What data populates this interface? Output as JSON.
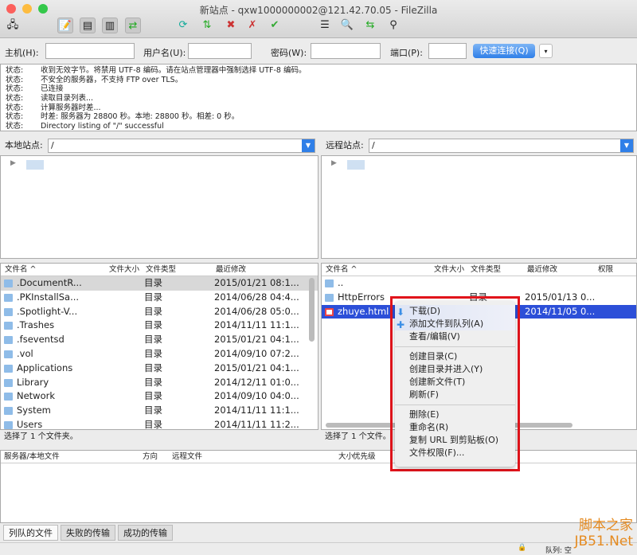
{
  "window": {
    "title": "新站点 - qxw1000000002@121.42.70.05 - FileZilla"
  },
  "toolbar": {
    "icons": [
      "site-manager-icon",
      "message-log-icon",
      "local-tree-icon",
      "remote-tree-icon",
      "transfer-queue-icon",
      "refresh-icon",
      "process-queue-icon",
      "cancel-icon",
      "disconnect-icon",
      "reconnect-icon",
      "filter-icon",
      "compare-icon",
      "sync-browse-icon",
      "search-icon"
    ]
  },
  "quickconnect": {
    "host_label": "主机(H):",
    "user_label": "用户名(U):",
    "pass_label": "密码(W):",
    "port_label": "端口(P):",
    "host": "",
    "user": "",
    "pass": "",
    "port": "",
    "button": "快速连接(Q)",
    "dropdown": "▾"
  },
  "log": [
    {
      "k": "状态:",
      "v": "收到无效字节。将禁用 UTF-8 编码。请在站点管理器中强制选择 UTF-8 编码。"
    },
    {
      "k": "状态:",
      "v": "不安全的服务器，不支持 FTP over TLS。"
    },
    {
      "k": "状态:",
      "v": "已连接"
    },
    {
      "k": "状态:",
      "v": "读取目录列表..."
    },
    {
      "k": "状态:",
      "v": "计算服务器时差..."
    },
    {
      "k": "状态:",
      "v": "时差: 服务器为 28800 秒。本地: 28800 秒。相差: 0 秒。"
    },
    {
      "k": "状态:",
      "v": "Directory listing of \"/\" successful"
    }
  ],
  "local": {
    "site_label": "本地站点:",
    "path": "/",
    "cols": [
      "文件名 ^",
      "文件大小",
      "文件类型",
      "最近修改"
    ],
    "files": [
      {
        "name": ".DocumentR...",
        "type": "目录",
        "date": "2015/01/21 08:1..."
      },
      {
        "name": ".PKInstallSa...",
        "type": "目录",
        "date": "2014/06/28 04:4..."
      },
      {
        "name": ".Spotlight-V...",
        "type": "目录",
        "date": "2014/06/28 05:0..."
      },
      {
        "name": ".Trashes",
        "type": "目录",
        "date": "2014/11/11 11:1..."
      },
      {
        "name": ".fseventsd",
        "type": "目录",
        "date": "2015/01/21 04:1..."
      },
      {
        "name": ".vol",
        "type": "目录",
        "date": "2014/09/10 07:2..."
      },
      {
        "name": "Applications",
        "type": "目录",
        "date": "2015/01/21 04:1..."
      },
      {
        "name": "Library",
        "type": "目录",
        "date": "2014/12/11 01:0..."
      },
      {
        "name": "Network",
        "type": "目录",
        "date": "2014/09/10 04:0..."
      },
      {
        "name": "System",
        "type": "目录",
        "date": "2014/11/11 11:1..."
      },
      {
        "name": "Users",
        "type": "目录",
        "date": "2014/11/11 11:2..."
      }
    ],
    "status": "选择了 1 个文件夹。"
  },
  "remote": {
    "site_label": "远程站点:",
    "path": "/",
    "cols": [
      "文件名 ^",
      "文件大小",
      "文件类型",
      "最近修改",
      "权限"
    ],
    "files": [
      {
        "name": "..",
        "type": "",
        "date": ""
      },
      {
        "name": "HttpErrors",
        "type": "目录",
        "date": "2015/01/13 0..."
      },
      {
        "name": "zhuye.html",
        "type": "",
        "date": "2014/11/05 0..."
      }
    ],
    "status": "选择了 1 个文件。"
  },
  "context_menu": [
    {
      "label": "下载(D)",
      "icon": "download-icon"
    },
    {
      "label": "添加文件到队列(A)",
      "icon": "add-queue-icon"
    },
    {
      "label": "查看/编辑(V)"
    },
    {
      "sep": true
    },
    {
      "label": "创建目录(C)"
    },
    {
      "label": "创建目录并进入(Y)"
    },
    {
      "label": "创建新文件(T)"
    },
    {
      "label": "刷新(F)"
    },
    {
      "sep": true
    },
    {
      "label": "删除(E)"
    },
    {
      "label": "重命名(R)"
    },
    {
      "label": "复制 URL 到剪贴板(O)"
    },
    {
      "label": "文件权限(F)..."
    }
  ],
  "queue": {
    "cols": [
      "服务器/本地文件",
      "方向",
      "远程文件",
      "大小",
      "优先级"
    ],
    "tabs": [
      "列队的文件",
      "失败的传输",
      "成功的传输"
    ],
    "status": "队列: 空"
  },
  "watermark": "脚本之家 JB51.Net",
  "colors": {
    "selection": "#2c4fd8",
    "highlight_box": "#e1141b",
    "accent": "#2f7fe8"
  }
}
